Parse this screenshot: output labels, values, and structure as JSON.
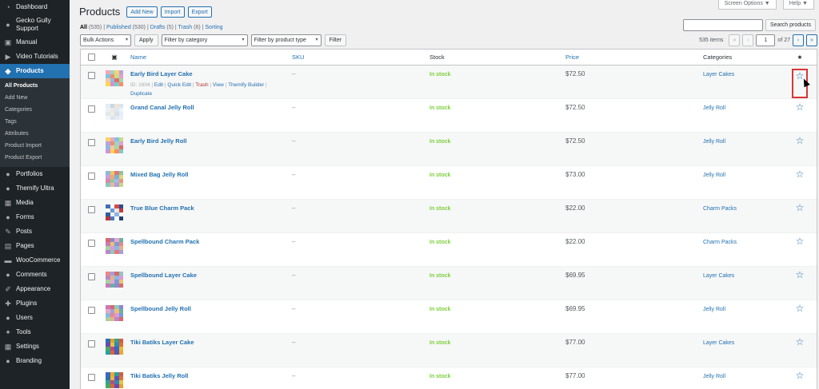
{
  "sidebar": {
    "items": [
      {
        "label": "Dashboard",
        "icon": "dashboard-icon",
        "glyph": "◔"
      },
      {
        "label": "Gecko Gully Support",
        "icon": "support-icon",
        "glyph": "●",
        "two": true
      },
      {
        "label": "Manual",
        "icon": "book-icon",
        "glyph": "▣"
      },
      {
        "label": "Video Tutorials",
        "icon": "video-icon",
        "glyph": "▶"
      },
      {
        "label": "Products",
        "icon": "products-icon",
        "glyph": "◆",
        "active": true
      }
    ],
    "submenu": [
      "All Products",
      "Add New",
      "Categories",
      "Tags",
      "Attributes",
      "Product Import",
      "Product Export"
    ],
    "items2": [
      {
        "label": "Portfolios",
        "icon": "portfolio-icon",
        "glyph": "●"
      },
      {
        "label": "Themify Ultra",
        "icon": "themify-icon",
        "glyph": "●"
      },
      {
        "label": "Media",
        "icon": "media-icon",
        "glyph": "▦"
      },
      {
        "label": "Forms",
        "icon": "forms-icon",
        "glyph": "●"
      },
      {
        "label": "Posts",
        "icon": "pin-icon",
        "glyph": "✎"
      },
      {
        "label": "Pages",
        "icon": "pages-icon",
        "glyph": "▤"
      },
      {
        "label": "WooCommerce",
        "icon": "woocommerce-icon",
        "glyph": "▬"
      },
      {
        "label": "Comments",
        "icon": "comments-icon",
        "glyph": "●"
      },
      {
        "label": "Appearance",
        "icon": "appearance-icon",
        "glyph": "✐"
      },
      {
        "label": "Plugins",
        "icon": "plugins-icon",
        "glyph": "✚"
      },
      {
        "label": "Users",
        "icon": "users-icon",
        "glyph": "●"
      },
      {
        "label": "Tools",
        "icon": "tools-icon",
        "glyph": "✦"
      },
      {
        "label": "Settings",
        "icon": "settings-icon",
        "glyph": "▦"
      },
      {
        "label": "Branding",
        "icon": "branding-icon",
        "glyph": "●"
      }
    ]
  },
  "header": {
    "title": "Products",
    "add_new": "Add New",
    "import": "Import",
    "export": "Export",
    "screen_options": "Screen Options ▼",
    "help": "Help ▼"
  },
  "filters_links": {
    "all": "All",
    "all_count": "(535)",
    "published": "Published",
    "published_count": "(530)",
    "drafts": "Drafts",
    "drafts_count": "(5)",
    "trash": "Trash",
    "trash_count": "(6)",
    "sorting": "Sorting"
  },
  "search": {
    "button": "Search products"
  },
  "tablenav": {
    "bulk_actions": "Bulk Actions",
    "apply": "Apply",
    "filter_category": "Filter by category",
    "filter_type": "Filter by product type",
    "filter": "Filter"
  },
  "pagination": {
    "items": "535 items",
    "first": "«",
    "prev": "‹",
    "current": "1",
    "of": "of 27",
    "next": "›",
    "last": "»"
  },
  "columns": {
    "name": "Name",
    "sku": "SKU",
    "stock": "Stock",
    "price": "Price",
    "categories": "Categories",
    "featured": "★"
  },
  "row_actions": {
    "id": "ID: 1604",
    "edit": "Edit",
    "quick_edit": "Quick Edit",
    "trash": "Trash",
    "view": "View",
    "builder": "Themify Builder",
    "duplicate": "Duplicate"
  },
  "products": [
    {
      "name": "Early Bird Layer Cake",
      "sku": "–",
      "stock": "In stock",
      "price": "$72.50",
      "category": "Layer Cakes",
      "thumb": [
        "#f2a7b8",
        "#9dd3c8",
        "#f6d36b",
        "#b7a3de",
        "#7fc2e8",
        "#f08c73",
        "#c6e07f",
        "#e3a0d0",
        "#f7c59f",
        "#92b8e0",
        "#e36b6b",
        "#a5d6a7",
        "#ffd54f",
        "#ce93d8",
        "#80cbc4",
        "#ff8a65"
      ]
    },
    {
      "name": "Grand Canal Jelly Roll",
      "sku": "–",
      "stock": "In stock",
      "price": "$72.50",
      "category": "Jelly Roll",
      "thumb": [
        "#e4ecf4",
        "#c8d8e8",
        "#f4e4d4",
        "#d8e4f0",
        "#e8f0f8",
        "#f0e8dc",
        "#dce8f4",
        "#ecf4fc",
        "#e0e8f0",
        "#f4ece0",
        "#d4e0ec",
        "#e8eef4",
        "#f0f4f8",
        "#dce4ec",
        "#e4ecf0",
        "#ecf0f4"
      ]
    },
    {
      "name": "Early Bird Jelly Roll",
      "sku": "–",
      "stock": "In stock",
      "price": "$72.50",
      "category": "Jelly Roll",
      "thumb": [
        "#f6d36b",
        "#f2a7b8",
        "#7fc2e8",
        "#c6e07f",
        "#b7a3de",
        "#f08c73",
        "#9dd3c8",
        "#e3a0d0",
        "#92b8e0",
        "#f7c59f",
        "#a5d6a7",
        "#e36b6b",
        "#ce93d8",
        "#ffd54f",
        "#ff8a65",
        "#80cbc4"
      ]
    },
    {
      "name": "Mixed Bag Jelly Roll",
      "sku": "–",
      "stock": "In stock",
      "price": "$73.00",
      "category": "Jelly Roll",
      "thumb": [
        "#8fb8d8",
        "#e8c86a",
        "#d87a7a",
        "#8fc49a",
        "#c9a0dc",
        "#f0a868",
        "#7ab0d8",
        "#e2d47a",
        "#d88aa8",
        "#98c898",
        "#a8b8e8",
        "#e89878",
        "#88c8c0",
        "#e8b8a0",
        "#b0a0d8",
        "#c8d888"
      ]
    },
    {
      "name": "True Blue Charm Pack",
      "sku": "–",
      "stock": "In stock",
      "price": "$22.00",
      "category": "Charm Packs",
      "thumb": [
        "#3f6fb5",
        "#ffffff",
        "#d94a4a",
        "#2b4f8a",
        "#ffffff",
        "#6a9ad6",
        "#e8e8e8",
        "#c33c3c",
        "#2e5f9e",
        "#f2f2f2",
        "#8fb5e6",
        "#ffffff",
        "#b93838",
        "#4a7cc4",
        "#ffffff",
        "#1f3f73"
      ]
    },
    {
      "name": "Spellbound Charm Pack",
      "sku": "–",
      "stock": "In stock",
      "price": "$22.00",
      "category": "Charm Packs",
      "thumb": [
        "#d86a6a",
        "#8a8ad0",
        "#e8a8c8",
        "#6ab0a8",
        "#c87ab8",
        "#f0c070",
        "#7a9ad8",
        "#e88888",
        "#a8d0a0",
        "#d89ad8",
        "#88b8e0",
        "#e8b088",
        "#b888c8",
        "#90c8c0",
        "#e87878",
        "#a0a0e0"
      ]
    },
    {
      "name": "Spellbound Layer Cake",
      "sku": "–",
      "stock": "In stock",
      "price": "$69.95",
      "category": "Layer Cakes",
      "thumb": [
        "#e88888",
        "#a0a0e0",
        "#d86a6a",
        "#90c8c0",
        "#b888c8",
        "#e8b088",
        "#88b8e0",
        "#d89ad8",
        "#a8d0a0",
        "#e8a8c8",
        "#7a9ad8",
        "#f0c070",
        "#c87ab8",
        "#6ab0a8",
        "#8a8ad0",
        "#d86a6a"
      ]
    },
    {
      "name": "Spellbound Jelly Roll",
      "sku": "–",
      "stock": "In stock",
      "price": "$69.95",
      "category": "Jelly Roll",
      "thumb": [
        "#c87ab8",
        "#d86a6a",
        "#90c8c0",
        "#8a8ad0",
        "#e8a8c8",
        "#a0a0e0",
        "#f0c070",
        "#6ab0a8",
        "#88b8e0",
        "#e88888",
        "#d89ad8",
        "#7a9ad8",
        "#a8d0a0",
        "#e8b088",
        "#b888c8",
        "#d86a6a"
      ]
    },
    {
      "name": "Tiki Batiks Layer Cake",
      "sku": "–",
      "stock": "In stock",
      "price": "$77.00",
      "category": "Layer Cakes",
      "thumb": [
        "#2f6fb0",
        "#e8a030",
        "#3aa08a",
        "#d85a48",
        "#6a4ab0",
        "#f0c040",
        "#2a8ab8",
        "#e07030",
        "#48a868",
        "#c84878",
        "#3868c0",
        "#e8b838",
        "#28a0a0",
        "#d86838",
        "#5858b8",
        "#f0a828"
      ]
    },
    {
      "name": "Tiki Batiks Jelly Roll",
      "sku": "–",
      "stock": "In stock",
      "price": "$77.00",
      "category": "Jelly Roll",
      "thumb": [
        "#3868c0",
        "#f0a828",
        "#28a0a0",
        "#d85a48",
        "#2f6fb0",
        "#e8b838",
        "#5858b8",
        "#e07030",
        "#3aa08a",
        "#c84878",
        "#2a8ab8",
        "#f0c040",
        "#48a868",
        "#d86838",
        "#6a4ab0",
        "#e8a030"
      ]
    }
  ],
  "colors": {
    "sidebar": "#1d2327",
    "active": "#2271b1",
    "link": "#2271b1",
    "instock": "#7ad03a",
    "trash": "#b32d2e",
    "highlight": "#d63638"
  }
}
